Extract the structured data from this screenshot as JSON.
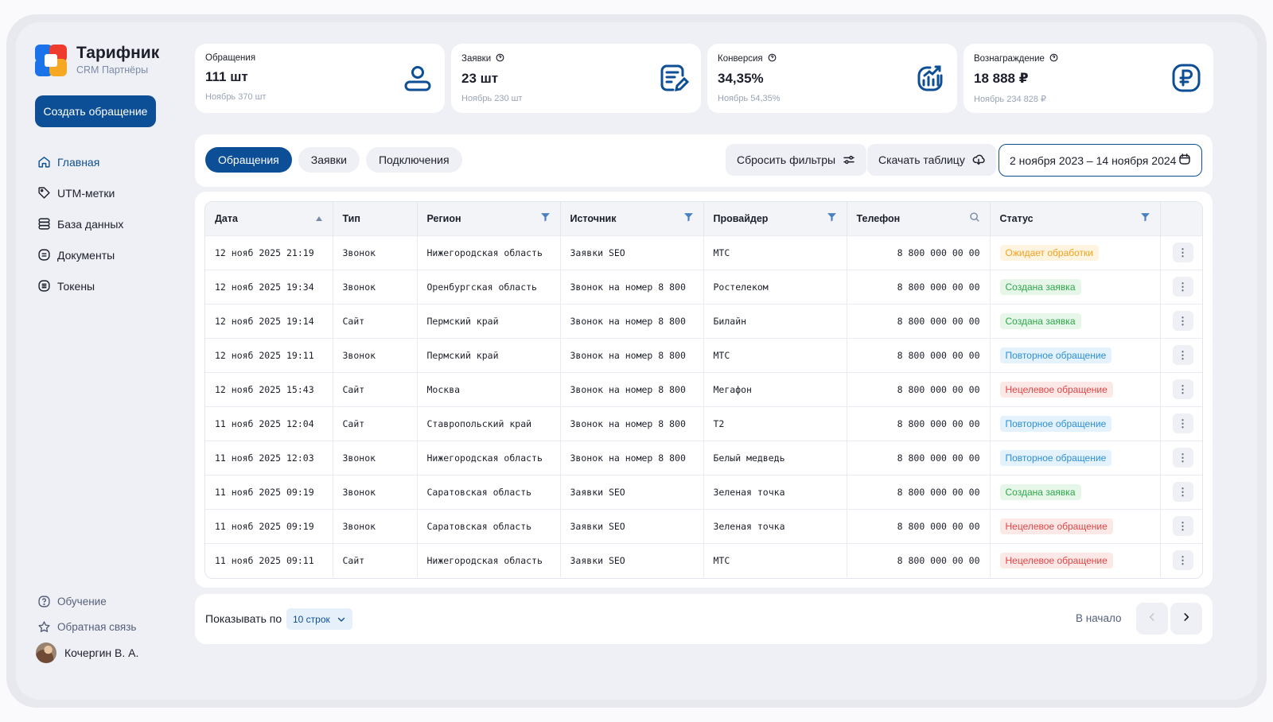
{
  "brand": {
    "name": "Тарифник",
    "subtitle": "CRM Партнёры"
  },
  "sidebar": {
    "create_button": "Создать обращение",
    "nav": [
      {
        "label": "Главная",
        "icon": "home-icon",
        "active": true
      },
      {
        "label": "UTM-метки",
        "icon": "tag-icon"
      },
      {
        "label": "База данных",
        "icon": "database-icon"
      },
      {
        "label": "Документы",
        "icon": "document-icon"
      },
      {
        "label": "Токены",
        "icon": "token-icon"
      }
    ],
    "bottom": [
      {
        "label": "Обучение",
        "icon": "question-circle-icon"
      },
      {
        "label": "Обратная связь",
        "icon": "star-icon"
      }
    ],
    "user": {
      "name": "Кочергин В. А."
    }
  },
  "stats": [
    {
      "title": "Обращения",
      "value": "111 шт",
      "sub": "Ноябрь 370 шт",
      "icon": "user-icon",
      "help": false
    },
    {
      "title": "Заявки",
      "value": "23 шт",
      "sub": "Ноябрь 230 шт",
      "icon": "edit-document-icon",
      "help": true
    },
    {
      "title": "Конверсия",
      "value": "34,35%",
      "sub": "Ноябрь 54,35%",
      "icon": "chart-growth-icon",
      "help": true
    },
    {
      "title": "Вознаграждение",
      "value": "18 888 ₽",
      "sub": "Ноябрь 234 828 ₽",
      "icon": "ruble-icon",
      "help": true
    }
  ],
  "toolbar": {
    "tabs": [
      "Обращения",
      "Заявки",
      "Подключения"
    ],
    "active_tab": 0,
    "reset_filters": "Сбросить фильтры",
    "download": "Скачать таблицу",
    "date_range": "2 ноября 2023 – 14 ноября 2024"
  },
  "table": {
    "columns": [
      "Дата",
      "Тип",
      "Регион",
      "Источник",
      "Провайдер",
      "Телефон",
      "Статус"
    ],
    "rows": [
      {
        "date": "12 нояб 2025 21:19",
        "type": "Звонок",
        "region": "Нижегородская область",
        "source": "Заявки SEO",
        "provider": "МТС",
        "phone": "8 800 000 00 00",
        "status": "Ожидает обработки",
        "status_kind": "wait"
      },
      {
        "date": "12 нояб 2025 19:34",
        "type": "Звонок",
        "region": "Оренбургская область",
        "source": "Звонок на номер 8 800",
        "provider": "Ростелеком",
        "phone": "8 800 000 00 00",
        "status": "Создана заявка",
        "status_kind": "created"
      },
      {
        "date": "12 нояб 2025 19:14",
        "type": "Сайт",
        "region": "Пермский край",
        "source": "Звонок на номер 8 800",
        "provider": "Билайн",
        "phone": "8 800 000 00 00",
        "status": "Создана заявка",
        "status_kind": "created"
      },
      {
        "date": "12 нояб 2025 19:11",
        "type": "Звонок",
        "region": "Пермский край",
        "source": "Звонок на номер 8 800",
        "provider": "МТС",
        "phone": "8 800 000 00 00",
        "status": "Повторное обращение",
        "status_kind": "repeat"
      },
      {
        "date": "12 нояб 2025 15:43",
        "type": "Сайт",
        "region": "Москва",
        "source": "Звонок на номер 8 800",
        "provider": "Мегафон",
        "phone": "8 800 000 00 00",
        "status": "Нецелевое обращение",
        "status_kind": "nontarget"
      },
      {
        "date": "11 нояб 2025 12:04",
        "type": "Сайт",
        "region": "Ставропольский край",
        "source": "Звонок на номер 8 800",
        "provider": "Т2",
        "phone": "8 800 000 00 00",
        "status": "Повторное обращение",
        "status_kind": "repeat"
      },
      {
        "date": "11 нояб 2025 12:03",
        "type": "Звонок",
        "region": "Нижегородская область",
        "source": "Звонок на номер 8 800",
        "provider": "Белый медведь",
        "phone": "8 800 000 00 00",
        "status": "Повторное обращение",
        "status_kind": "repeat"
      },
      {
        "date": "11 нояб 2025 09:19",
        "type": "Звонок",
        "region": "Саратовская область",
        "source": "Заявки SEO",
        "provider": "Зеленая точка",
        "phone": "8 800 000 00 00",
        "status": "Создана заявка",
        "status_kind": "created"
      },
      {
        "date": "11 нояб 2025 09:19",
        "type": "Звонок",
        "region": "Саратовская область",
        "source": "Заявки SEO",
        "provider": "Зеленая точка",
        "phone": "8 800 000 00 00",
        "status": "Нецелевое обращение",
        "status_kind": "nontarget"
      },
      {
        "date": "11 нояб 2025 09:11",
        "type": "Сайт",
        "region": "Нижегородская область",
        "source": "Заявки SEO",
        "provider": "МТС",
        "phone": "8 800 000 00 00",
        "status": "Нецелевое обращение",
        "status_kind": "nontarget"
      }
    ],
    "more_glyph": "⋮"
  },
  "footer": {
    "rows_label": "Показывать по",
    "rows_value": "10 строк",
    "to_start": "В начало"
  },
  "colors": {
    "primary": "#0d4f96",
    "background": "#eef0f5"
  }
}
